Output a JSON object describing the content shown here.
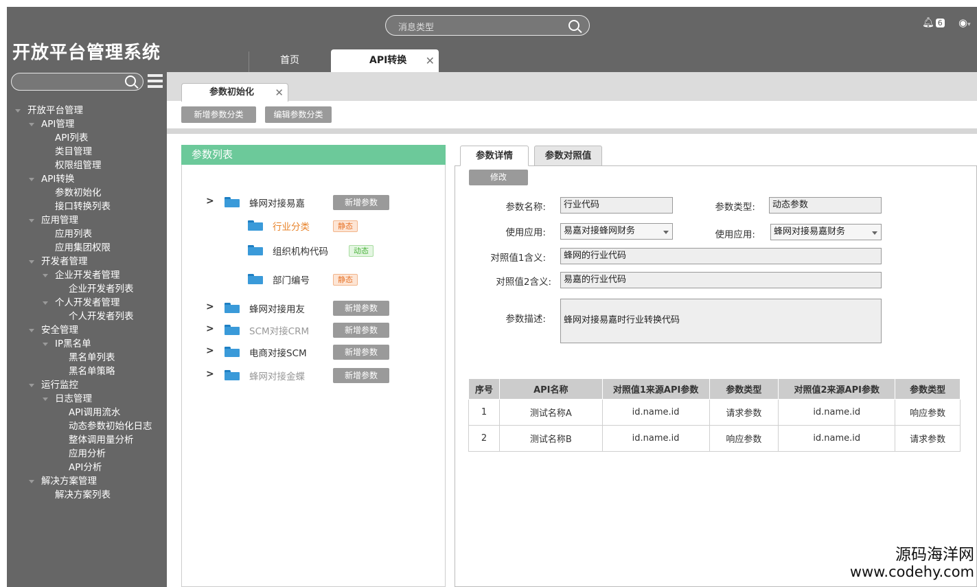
{
  "app": {
    "title": "开放平台管理系统"
  },
  "header": {
    "search_placeholder": "消息类型",
    "notification_count": "6",
    "tabs": [
      {
        "label": "首页"
      },
      {
        "label": "API转换",
        "close": "✕"
      }
    ]
  },
  "sidebar": {
    "search_placeholder": "",
    "tree": [
      {
        "label": "开放平台管理",
        "level": 0,
        "expanded": true
      },
      {
        "label": "API管理",
        "level": 1,
        "expanded": true
      },
      {
        "label": "API列表",
        "level": 2
      },
      {
        "label": "类目管理",
        "level": 2
      },
      {
        "label": "权限组管理",
        "level": 2
      },
      {
        "label": "API转换",
        "level": 1,
        "expanded": true
      },
      {
        "label": "参数初始化",
        "level": 2
      },
      {
        "label": "接口转换列表",
        "level": 2
      },
      {
        "label": "应用管理",
        "level": 1,
        "expanded": true
      },
      {
        "label": "应用列表",
        "level": 2
      },
      {
        "label": "应用集团权限",
        "level": 2
      },
      {
        "label": "开发者管理",
        "level": 1,
        "expanded": true
      },
      {
        "label": "企业开发者管理",
        "level": 2,
        "expanded": true
      },
      {
        "label": "企业开发者列表",
        "level": 3
      },
      {
        "label": "个人开发者管理",
        "level": 2,
        "expanded": true
      },
      {
        "label": "个人开发者列表",
        "level": 3
      },
      {
        "label": "安全管理",
        "level": 1,
        "expanded": true
      },
      {
        "label": "IP黑名单",
        "level": 2,
        "expanded": true
      },
      {
        "label": "黑名单列表",
        "level": 3
      },
      {
        "label": "黑名单策略",
        "level": 3
      },
      {
        "label": "运行监控",
        "level": 1,
        "expanded": true
      },
      {
        "label": "日志管理",
        "level": 2,
        "expanded": true
      },
      {
        "label": "API调用流水",
        "level": 3
      },
      {
        "label": "动态参数初始化日志",
        "level": 3
      },
      {
        "label": "整体调用量分析",
        "level": 3
      },
      {
        "label": "应用分析",
        "level": 3
      },
      {
        "label": "API分析",
        "level": 3
      },
      {
        "label": "解决方案管理",
        "level": 1,
        "expanded": true
      },
      {
        "label": "解决方案列表",
        "level": 2
      }
    ]
  },
  "subtab": {
    "label": "参数初始化",
    "close": "✕"
  },
  "toolbar": {
    "add_category": "新增参数分类",
    "edit_category": "编辑参数分类"
  },
  "param_list": {
    "title": "参数列表",
    "arrow": ">",
    "add_param_label": "新增参数",
    "groups": [
      {
        "label": "蜂网对接易嘉",
        "color": "#333333",
        "children": [
          {
            "label": "行业分类",
            "badge": "静态",
            "badge_type": "static",
            "color": "#e8832a"
          },
          {
            "label": "组织机构代码",
            "badge": "动态",
            "badge_type": "dynamic",
            "color": "#333333"
          },
          {
            "label": "部门编号",
            "badge": "静态",
            "badge_type": "static",
            "color": "#333333"
          }
        ]
      },
      {
        "label": "蜂网对接用友",
        "color": "#333333"
      },
      {
        "label": "SCM对接CRM",
        "color": "#999999"
      },
      {
        "label": "电商对接SCM",
        "color": "#333333"
      },
      {
        "label": "蜂网对接金蝶",
        "color": "#999999"
      }
    ]
  },
  "detail": {
    "tabs": [
      "参数详情",
      "参数对照值"
    ],
    "edit_label": "修改",
    "param_name_label": "参数名称:",
    "param_name_value": "行业代码",
    "param_type_label": "参数类型:",
    "param_type_value": "动态参数",
    "app1_label": "使用应用:",
    "app1_value": "易嘉对接蜂网财务",
    "app2_label": "使用应用:",
    "app2_value": "蜂网对接易嘉财务",
    "ref1_label": "对照值1含义:",
    "ref1_value": "蜂网的行业代码",
    "ref2_label": "对照值2含义:",
    "ref2_value": "易嘉的行业代码",
    "desc_label": "参数描述:",
    "desc_value": "蜂网对接易嘉时行业转换代码"
  },
  "table": {
    "headers": [
      "序号",
      "API名称",
      "对照值1来源API参数",
      "参数类型",
      "对照值2来源API参数",
      "参数类型"
    ],
    "rows": [
      [
        "1",
        "测试名称A",
        "id.name.id",
        "请求参数",
        "id.name.id",
        "响应参数"
      ],
      [
        "2",
        "测试名称B",
        "id.name.id",
        "响应参数",
        "id.name.id",
        "请求参数"
      ]
    ]
  },
  "watermark": {
    "line1": "源码海洋网",
    "line2": "www.codehy.com"
  }
}
